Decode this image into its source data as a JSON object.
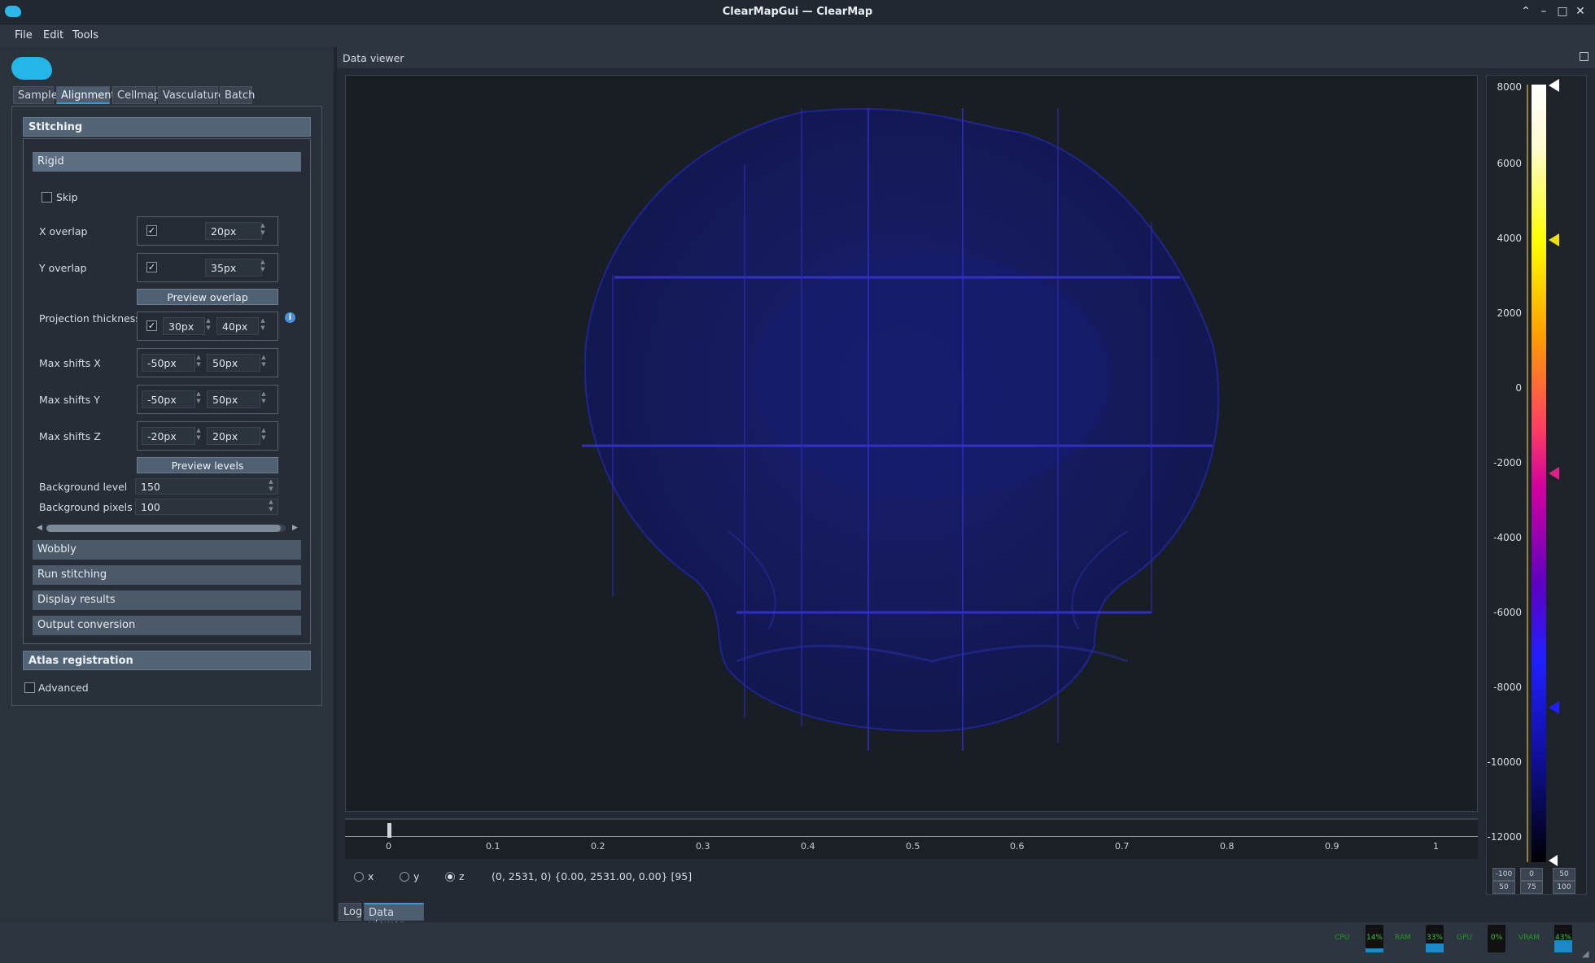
{
  "window": {
    "title": "ClearMapGui — ClearMap",
    "controls": [
      "⌃",
      "–",
      "□",
      "✕"
    ]
  },
  "menu": [
    "File",
    "Edit",
    "Tools"
  ],
  "tabs": [
    "Sample",
    "Alignment",
    "Cellmap",
    "Vasculature",
    "Batch"
  ],
  "active_tab": "Alignment",
  "stitching": {
    "header": "Stitching",
    "rigid_header": "Rigid",
    "skip_label": "Skip",
    "x_overlap": {
      "label": "X overlap",
      "value": "20px",
      "checked": true
    },
    "y_overlap": {
      "label": "Y overlap",
      "value": "35px",
      "checked": true
    },
    "preview_overlap_btn": "Preview overlap",
    "projection_thickness": {
      "label": "Projection thickness",
      "value1": "30px",
      "value2": "40px",
      "checked": true
    },
    "max_shifts_x": {
      "label": "Max shifts X",
      "min": "-50px",
      "max": "50px"
    },
    "max_shifts_y": {
      "label": "Max shifts Y",
      "min": "-50px",
      "max": "50px"
    },
    "max_shifts_z": {
      "label": "Max shifts Z",
      "min": "-20px",
      "max": "20px"
    },
    "preview_levels_btn": "Preview levels",
    "background_level": {
      "label": "Background level",
      "value": "150"
    },
    "background_pixels": {
      "label": "Background pixels",
      "value": "100"
    },
    "sub_sections": [
      "Wobbly",
      "Run stitching",
      "Display results",
      "Output conversion"
    ]
  },
  "atlas_header": "Atlas registration",
  "advanced_label": "Advanced",
  "dock_title": "Data viewer",
  "timeline_ticks": [
    "0",
    "0.1",
    "0.2",
    "0.3",
    "0.4",
    "0.5",
    "0.6",
    "0.7",
    "0.8",
    "0.9",
    "1"
  ],
  "axis_radios": {
    "x": "x",
    "y": "y",
    "z": "z",
    "selected": "z"
  },
  "coords_readout": "(0, 2531, 0) {0.00, 2531.00, 0.00} [95]",
  "bottom_tabs": [
    "Log",
    "Data viewer"
  ],
  "active_bottom_tab": "Data viewer",
  "lut": {
    "labels": [
      "8000",
      "6000",
      "4000",
      "2000",
      "0",
      "-2000",
      "-4000",
      "-6000",
      "-8000",
      "-10000",
      "-12000"
    ],
    "buttons": [
      [
        "-100",
        "50"
      ],
      [
        "0",
        "75"
      ],
      [
        "50",
        "100"
      ]
    ]
  },
  "status_meters": [
    {
      "label": "CPU",
      "value": "14%",
      "fill": 0.14
    },
    {
      "label": "RAM",
      "value": "33%",
      "fill": 0.33
    },
    {
      "label": "GPU",
      "value": "0%",
      "fill": 0.0
    },
    {
      "label": "VRAM",
      "value": "43%",
      "fill": 0.43
    }
  ]
}
